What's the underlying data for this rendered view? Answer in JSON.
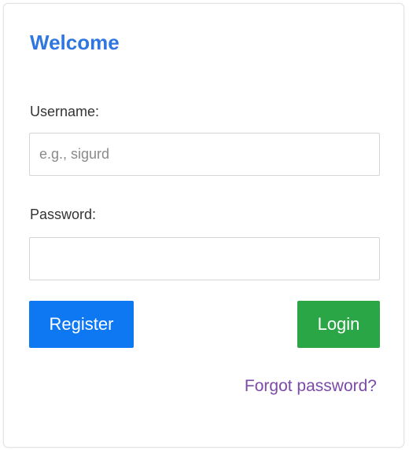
{
  "form": {
    "title": "Welcome",
    "username_label": "Username:",
    "username_placeholder": "e.g., sigurd",
    "username_value": "",
    "password_label": "Password:",
    "password_placeholder": "",
    "password_value": "",
    "register_label": "Register",
    "login_label": "Login",
    "forgot_label": "Forgot password?"
  },
  "colors": {
    "title": "#2f76e0",
    "register_button": "#0d78f2",
    "login_button": "#2aa646",
    "forgot_link": "#7b4aa6"
  }
}
